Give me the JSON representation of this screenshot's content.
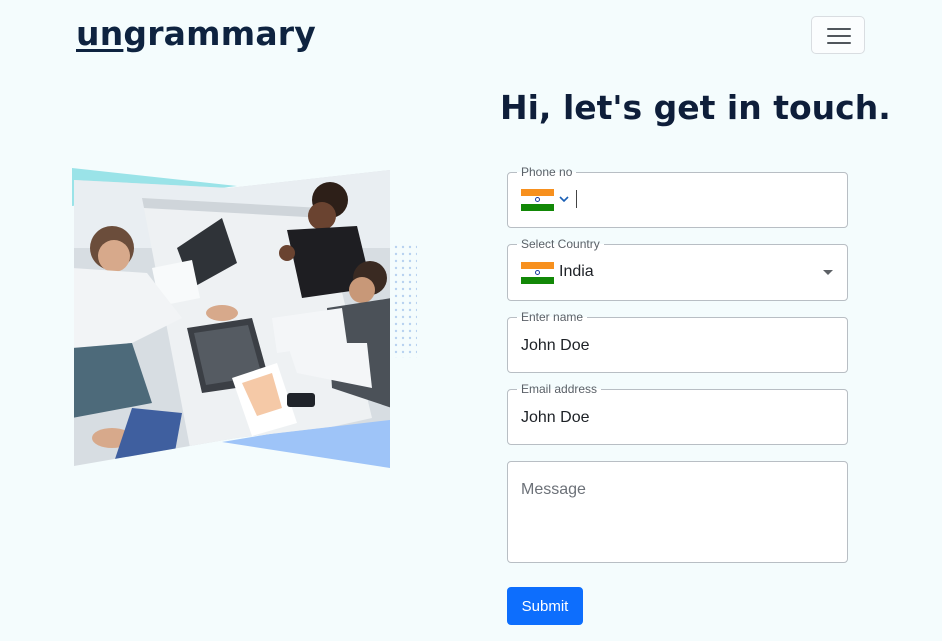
{
  "navbar": {
    "brand_underlined": "un",
    "brand_rest": "grammary",
    "toggler_icon": "hamburger-menu-icon"
  },
  "contact": {
    "heading": "Hi, let's get in touch.",
    "hero_image_description": "hero-photo-business-handshake",
    "form": {
      "phone": {
        "label": "Phone no",
        "value": "",
        "flag": "india-flag-icon"
      },
      "country": {
        "label": "Select Country",
        "value": "India",
        "flag": "india-flag-icon"
      },
      "name": {
        "label": "Enter name",
        "value": "John Doe"
      },
      "email": {
        "label": "Email address",
        "value": "John Doe"
      },
      "message": {
        "placeholder": "Message",
        "value": ""
      },
      "submit_label": "Submit"
    }
  },
  "colors": {
    "page_bg": "#f4fcfd",
    "primary": "#0d6efd",
    "heading_text": "#0e1e3a"
  }
}
